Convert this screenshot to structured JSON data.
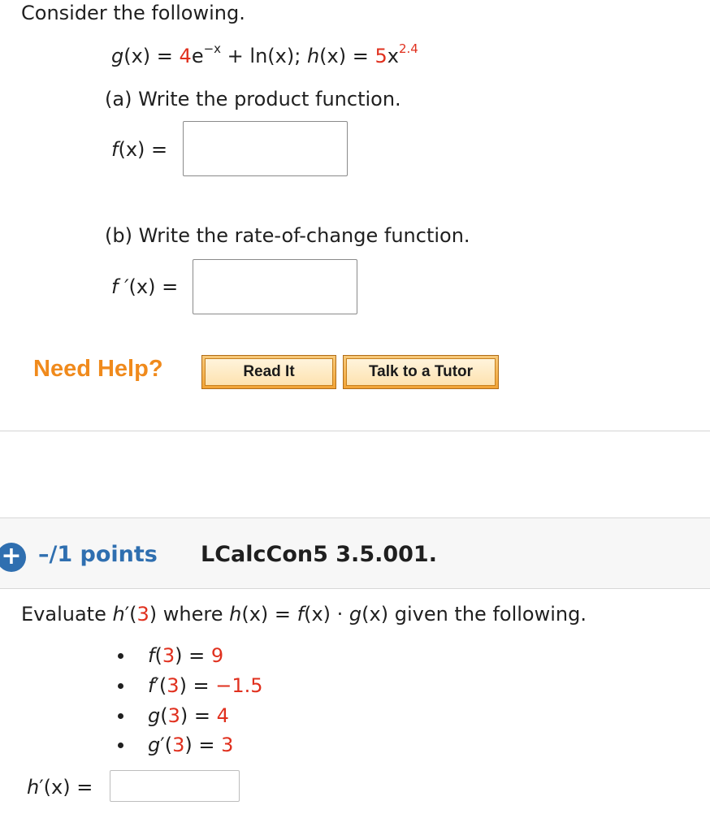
{
  "q1": {
    "prompt": "Consider the following.",
    "g_lhs": "g",
    "g_arg": "(x)",
    "g_eq": " = ",
    "g_coef": "4",
    "g_base": "e",
    "g_exp": "−x",
    "g_plus": " + ln(x); ",
    "h_lhs": "h",
    "h_arg": "(x)",
    "h_eq": " = ",
    "h_coef": "5",
    "h_var": "x",
    "h_exp": "2.4",
    "part_a": "(a) Write the product function.",
    "fa_label": "f",
    "fa_rest": "(x)  =",
    "part_b": "(b) Write the rate-of-change function.",
    "fb_label": "f ′",
    "fb_rest": "(x)  =",
    "need_help": "Need Help?",
    "read_it": "Read It",
    "talk_tutor": "Talk to a Tutor"
  },
  "q2": {
    "plus_icon": "+",
    "points": "–/1 points",
    "id": "LCalcCon5 3.5.001.",
    "prompt_1": "Evaluate  ",
    "prompt_h": "h",
    "prompt_2": "′(",
    "prompt_3val": "3",
    "prompt_4": ")  where  ",
    "prompt_h2": "h",
    "prompt_5": "(x)  =  ",
    "prompt_f": "f",
    "prompt_6": "(x)  ·  ",
    "prompt_g": "g",
    "prompt_7": "(x)  given the following.",
    "items": [
      {
        "fn": "f",
        "prime": "",
        "arg": "3",
        "val": "9"
      },
      {
        "fn": "f",
        "prime": "′",
        "arg": "3",
        "val": "−1.5"
      },
      {
        "fn": "g",
        "prime": "",
        "arg": "3",
        "val": "4"
      },
      {
        "fn": "g",
        "prime": "′",
        "arg": "3",
        "val": "3"
      }
    ],
    "answer_fn": "h",
    "answer_rest": "′(x)  ="
  },
  "colors": {
    "accent_red": "#e0301e",
    "link_blue": "#2f6fb0",
    "help_orange": "#f08a1c"
  }
}
